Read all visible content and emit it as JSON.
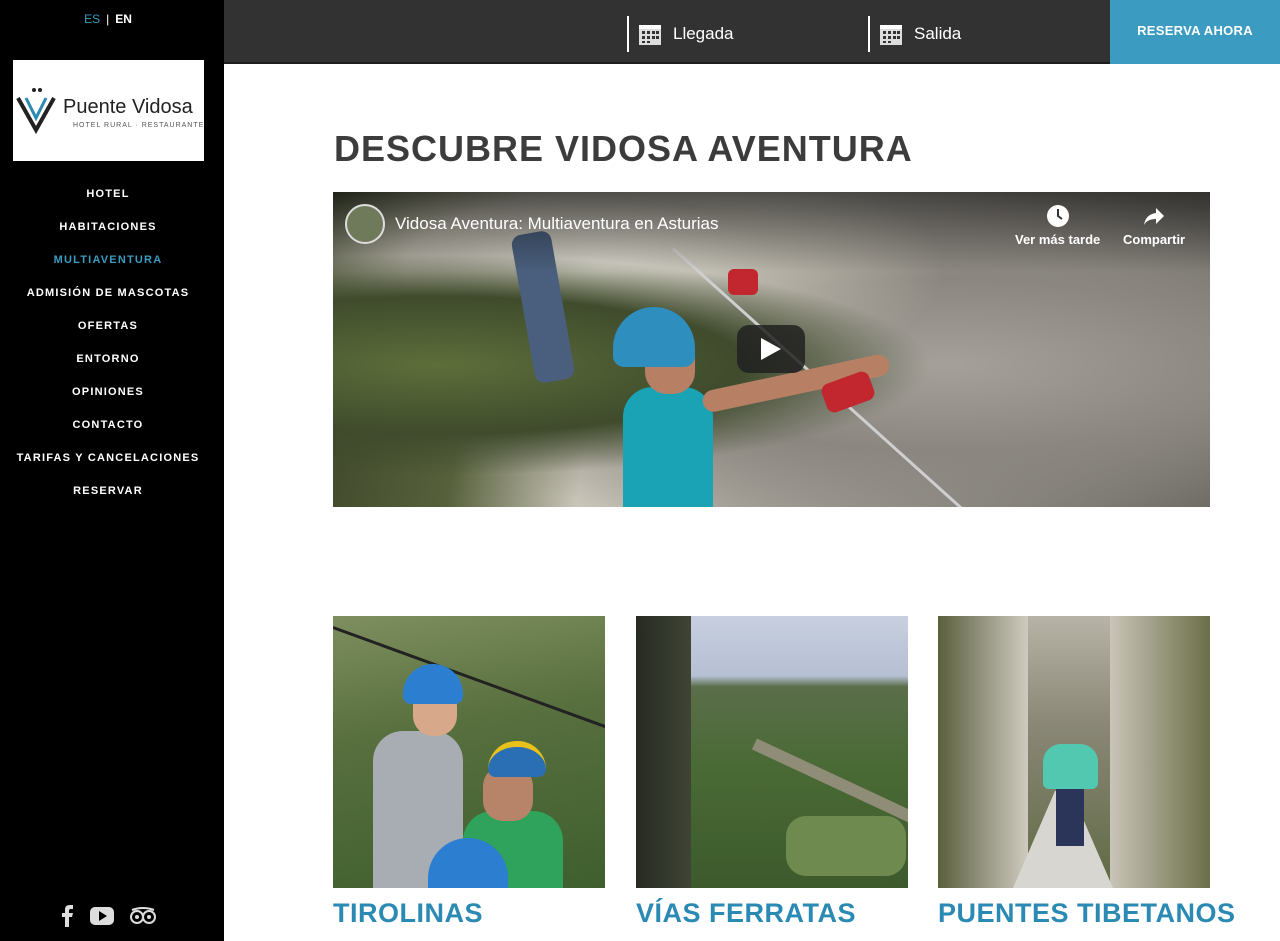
{
  "language": {
    "es": "ES",
    "separator": "|",
    "en": "EN",
    "active": "ES"
  },
  "logo": {
    "brand": "Puente Vidosa",
    "subtitle": "HOTEL RURAL · RESTAURANTE"
  },
  "nav": {
    "items": [
      {
        "label": "HOTEL",
        "active": false
      },
      {
        "label": "HABITACIONES",
        "active": false
      },
      {
        "label": "MULTIAVENTURA",
        "active": true
      },
      {
        "label": "ADMISIÓN DE MASCOTAS",
        "active": false
      },
      {
        "label": "OFERTAS",
        "active": false
      },
      {
        "label": "ENTORNO",
        "active": false
      },
      {
        "label": "OPINIONES",
        "active": false
      },
      {
        "label": "CONTACTO",
        "active": false
      },
      {
        "label": "TARIFAS Y CANCELACIONES",
        "active": false
      },
      {
        "label": "RESERVAR",
        "active": false
      }
    ]
  },
  "social": {
    "icons": [
      "facebook-icon",
      "youtube-icon",
      "tripadvisor-icon"
    ]
  },
  "booking": {
    "arrival_label": "Llegada",
    "departure_label": "Salida",
    "reserve_label": "RESERVA AHORA"
  },
  "main": {
    "title": "DESCUBRE VIDOSA AVENTURA",
    "video": {
      "title": "Vidosa Aventura: Multiaventura en Asturias",
      "watch_later": "Ver más tarde",
      "share": "Compartir"
    },
    "cards": [
      {
        "label": "TIROLINAS"
      },
      {
        "label": "VÍAS FERRATAS"
      },
      {
        "label": "PUENTES TIBETANOS"
      }
    ]
  },
  "colors": {
    "accent": "#3b9bc0",
    "sidebar": "#000000",
    "topbar": "#323232",
    "card_label": "#2b8ab3",
    "title": "#3c3c3c"
  }
}
